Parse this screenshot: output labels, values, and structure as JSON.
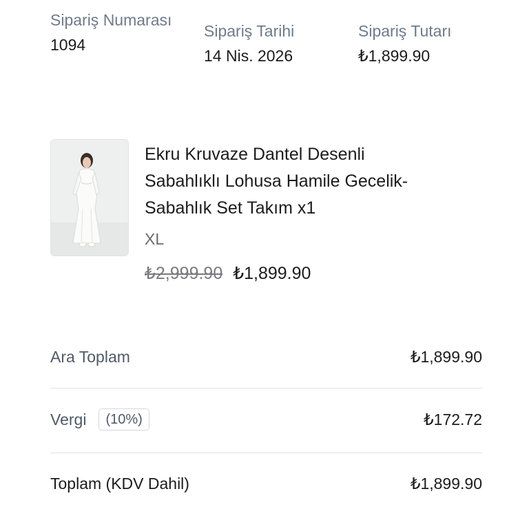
{
  "order_meta": {
    "number_label": "Sipariş Numarası",
    "number_value": "1094",
    "date_label": "Sipariş Tarihi",
    "date_value": "14 Nis. 2026",
    "total_label": "Sipariş Tutarı",
    "total_value": "₺1,899.90"
  },
  "product": {
    "title": "Ekru Kruvaze Dantel Desenli\nSabahlıklı Lohusa Hamile Gecelik-\nSabahlık Set Takım x1",
    "variant": "XL",
    "original_price": "₺2,999.90",
    "sale_price": "₺1,899.90",
    "image_icon": "product-photo-white-gown"
  },
  "summary": {
    "subtotal_label": "Ara Toplam",
    "subtotal_value": "₺1,899.90",
    "tax_label": "Vergi",
    "tax_rate": "(10%)",
    "tax_value": "₺172.72",
    "total_label": "Toplam (KDV Dahil)",
    "total_value": "₺1,899.90"
  },
  "colors": {
    "label_text": "#6e7b8a",
    "primary_text": "#1c1c1e",
    "divider": "#e2e2e5"
  }
}
